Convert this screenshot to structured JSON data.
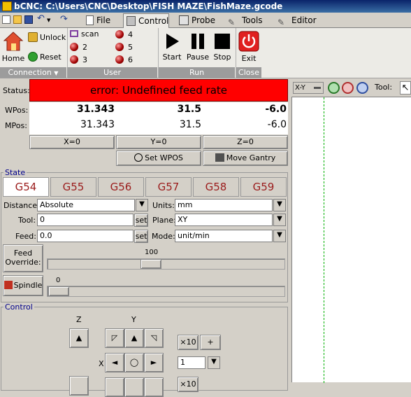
{
  "title": "bCNC: C:\\Users\\CNC\\Desktop\\FISH MAZE\\FishMaze.gcode",
  "tabs": [
    {
      "label": "File"
    },
    {
      "label": "Control"
    },
    {
      "label": "Probe"
    },
    {
      "label": "Tools"
    },
    {
      "label": "Editor"
    }
  ],
  "ribbon": {
    "connection": {
      "home": "Home",
      "unlock": "Unlock",
      "reset": "Reset",
      "label": "Connection"
    },
    "user": {
      "scan": "scan",
      "b2": "2",
      "b3": "3",
      "b4": "4",
      "b5": "5",
      "b6": "6",
      "label": "User"
    },
    "run": {
      "start": "Start",
      "pause": "Pause",
      "stop": "Stop",
      "label": "Run"
    },
    "close": {
      "exit": "Exit",
      "label": "Close"
    }
  },
  "status": {
    "label": "Status:",
    "text": "error: Undefined feed rate",
    "color": "#ff0000"
  },
  "position": {
    "wpos_label": "WPos:",
    "mpos_label": "MPos:",
    "wpos": {
      "x": "31.343",
      "y": "31.5",
      "z": "-6.0"
    },
    "mpos": {
      "x": "31.343",
      "y": "31.5",
      "z": "-6.0"
    },
    "zero_x": "X=0",
    "zero_y": "Y=0",
    "zero_z": "Z=0",
    "set_wpos": "Set WPOS",
    "move_gantry": "Move Gantry"
  },
  "state": {
    "title": "State",
    "wcs": [
      "G54",
      "G55",
      "G56",
      "G57",
      "G58",
      "G59"
    ],
    "distance_label": "Distance:",
    "distance": "Absolute",
    "units_label": "Units:",
    "units": "mm",
    "tool_label": "Tool:",
    "tool": "0",
    "set1": "set",
    "plane_label": "Plane:",
    "plane": "XY",
    "feed_label": "Feed:",
    "feed": "0.0",
    "set2": "set",
    "mode_label": "Mode:",
    "mode": "unit/min",
    "feed_override_1": "Feed",
    "feed_override_2": "Override:",
    "feed_override_value": "100",
    "spindle": "Spindle",
    "spindle_value": "0"
  },
  "control": {
    "title": "Control",
    "z_label": "Z",
    "y_label": "Y",
    "x_label": "X",
    "times10": "×10",
    "plus": "+",
    "step": "1",
    "times10b": "×10"
  },
  "canvas_toolbar": {
    "view": "X-Y",
    "tool_label": "Tool:"
  }
}
